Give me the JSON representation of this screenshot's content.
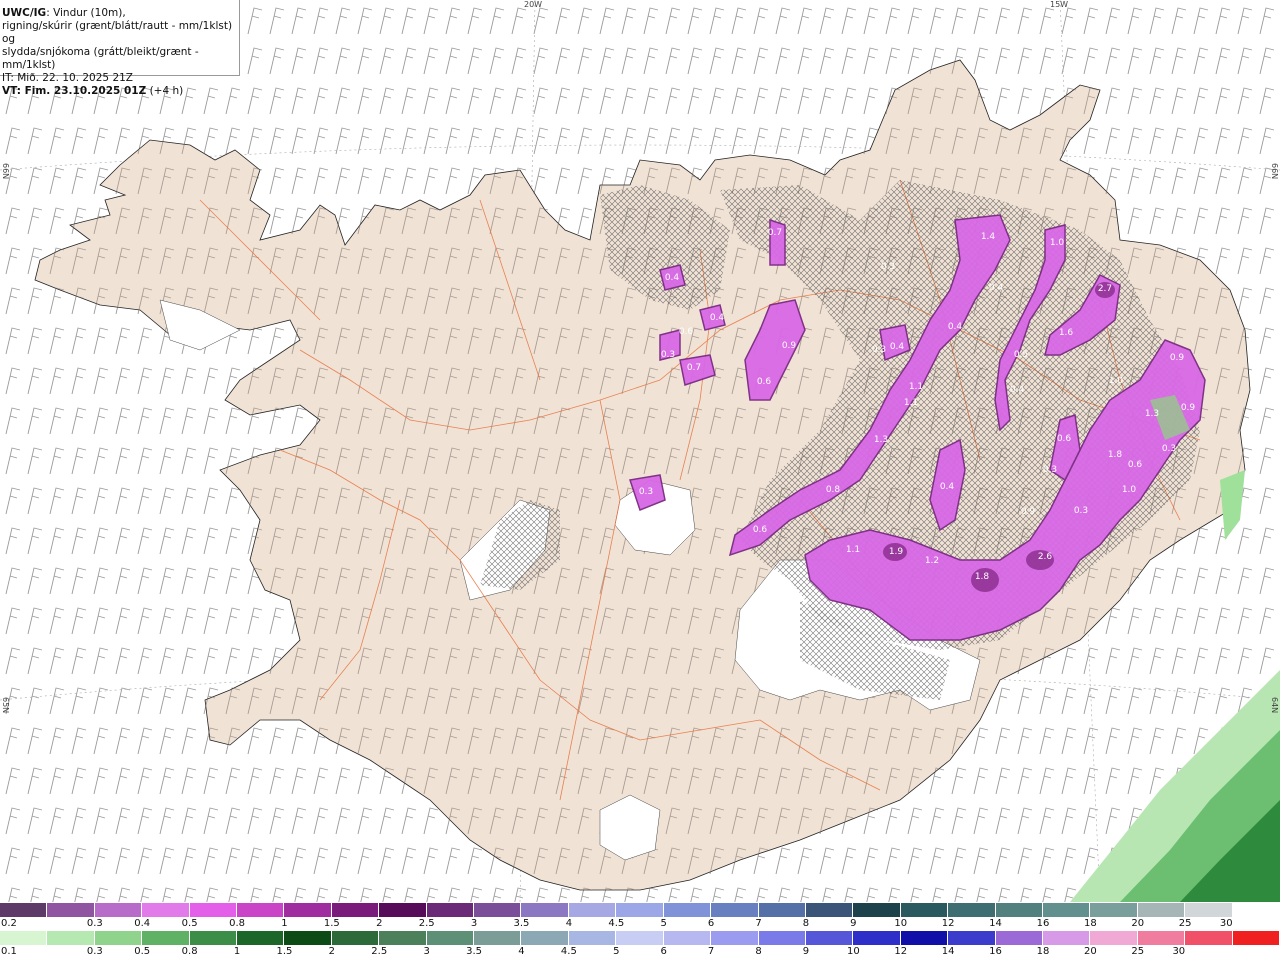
{
  "info": {
    "model": "UWC/IG",
    "line1_rest": ": Vindur (10m),",
    "line2": "rigning/skúrir (grænt/blátt/rautt - mm/1klst) og",
    "line3": "slydda/snjókoma (grátt/bleikt/grænt - mm/1klst)",
    "it": "IT: Mið. 22. 10. 2025 21Z",
    "vt_label": "VT: Fim. 23.10.2025 01Z",
    "vt_offset": " (+4 h)"
  },
  "grid_labels": {
    "lon_20w": "20W",
    "lon_15w": "15W",
    "lat_66n_left": "66N",
    "lat_66n_right": "66N",
    "lat_65n_left": "65N",
    "lat_64n_right": "64N"
  },
  "precip_labels": [
    "0.7",
    "1.4",
    "1.0",
    "0.3",
    "0.4",
    "2.7",
    "0.4",
    "0.4",
    "0.4",
    "1.6",
    "0.9",
    "0.6",
    "0.3",
    "0.7",
    "0.9",
    "0.6",
    "0.3",
    "0.4",
    "0.5",
    "0.4",
    "1.1",
    "1.1",
    "1.0",
    "1.3",
    "1.3",
    "0.9",
    "0.6",
    "0.3",
    "1.8",
    "0.6",
    "0.3",
    "0.8",
    "0.4",
    "1.0",
    "0.3",
    "0.9",
    "0.3",
    "1.1",
    "1.9",
    "1.2",
    "1.8",
    "2.6",
    "0.6"
  ],
  "colorbar_top": {
    "colors": [
      "#5e3a68",
      "#8f55a0",
      "#b66cc8",
      "#e07be9",
      "#e35ee9",
      "#c944c6",
      "#a02da0",
      "#7a1a7a",
      "#560c58",
      "#6b2a77",
      "#7b4e9a",
      "#8c77c2",
      "#a6a8e3",
      "#9ba7e6",
      "#8093d8",
      "#6880c0",
      "#5570a6",
      "#3a5577",
      "#1e424c",
      "#2a5a60",
      "#3e6e71",
      "#51807f",
      "#61908e",
      "#7a9e9c",
      "#a6b6b7",
      "#d1d6d9",
      "#ffffff"
    ],
    "ticks": [
      "0.2",
      "0.3",
      "0.4",
      "0.5",
      "0.8",
      "1",
      "1.5",
      "2",
      "2.5",
      "3",
      "3.5",
      "4",
      "4.5",
      "5",
      "6",
      "7",
      "8",
      "9",
      "10",
      "12",
      "14",
      "16",
      "18",
      "20",
      "25",
      "30"
    ]
  },
  "colorbar_bottom": {
    "colors": [
      "#d6f5d0",
      "#b6e8b2",
      "#8fd38c",
      "#5fb265",
      "#3b8d48",
      "#1d6629",
      "#0c4a16",
      "#2c6a3a",
      "#4c805a",
      "#5e8f77",
      "#7c9c97",
      "#8ba8b4",
      "#a8b6e3",
      "#c8cdf3",
      "#b8b8f0",
      "#9b9bf0",
      "#7a7ae8",
      "#5656d8",
      "#2e2ec8",
      "#1010a8",
      "#3c3ccc",
      "#9c6ad6",
      "#d79ae6",
      "#f0a8d4",
      "#f07ca0",
      "#f05068",
      "#f02020"
    ],
    "ticks": [
      "0.1",
      "0.3",
      "0.5",
      "0.8",
      "1",
      "1.5",
      "2",
      "2.5",
      "3",
      "3.5",
      "4",
      "4.5",
      "5",
      "6",
      "7",
      "8",
      "9",
      "10",
      "12",
      "14",
      "16",
      "18",
      "20",
      "25",
      "30"
    ]
  }
}
